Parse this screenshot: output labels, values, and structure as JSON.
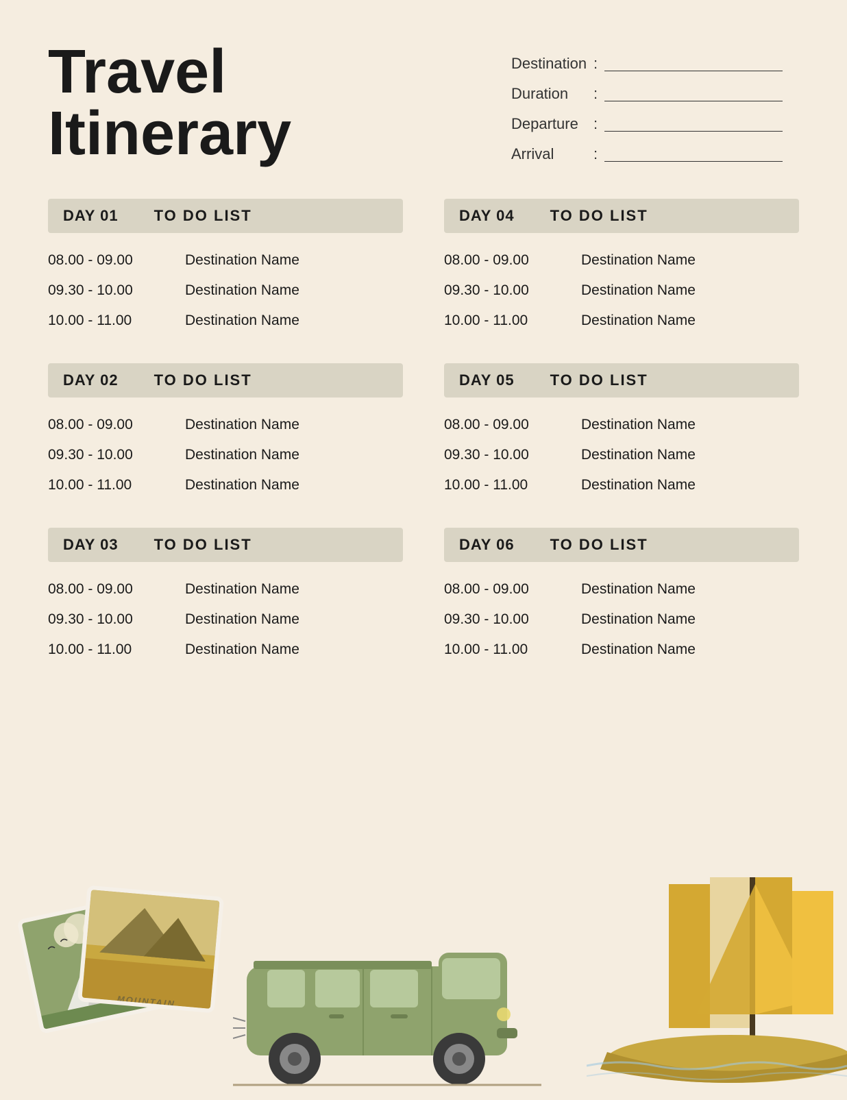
{
  "page": {
    "background_color": "#f5ede0"
  },
  "header": {
    "title_line1": "Travel",
    "title_line2": "Itinerary",
    "info_fields": [
      {
        "label": "Destination",
        "value": ""
      },
      {
        "label": "Duration",
        "value": ""
      },
      {
        "label": "Departure",
        "value": ""
      },
      {
        "label": "Arrival",
        "value": ""
      }
    ]
  },
  "days": [
    {
      "day_label": "DAY 01",
      "todo_label": "TO DO LIST",
      "items": [
        {
          "time": "08.00 - 09.00",
          "name": "Destination Name"
        },
        {
          "time": "09.30 - 10.00",
          "name": "Destination Name"
        },
        {
          "time": "10.00 - 11.00",
          "name": "Destination Name"
        }
      ]
    },
    {
      "day_label": "DAY 04",
      "todo_label": "TO DO LIST",
      "items": [
        {
          "time": "08.00 - 09.00",
          "name": "Destination Name"
        },
        {
          "time": "09.30 - 10.00",
          "name": "Destination Name"
        },
        {
          "time": "10.00 - 11.00",
          "name": "Destination Name"
        }
      ]
    },
    {
      "day_label": "DAY 02",
      "todo_label": "TO DO LIST",
      "items": [
        {
          "time": "08.00 - 09.00",
          "name": "Destination Name"
        },
        {
          "time": "09.30 - 10.00",
          "name": "Destination Name"
        },
        {
          "time": "10.00 - 11.00",
          "name": "Destination Name"
        }
      ]
    },
    {
      "day_label": "DAY 05",
      "todo_label": "TO DO LIST",
      "items": [
        {
          "time": "08.00 - 09.00",
          "name": "Destination Name"
        },
        {
          "time": "09.30 - 10.00",
          "name": "Destination Name"
        },
        {
          "time": "10.00 - 11.00",
          "name": "Destination Name"
        }
      ]
    },
    {
      "day_label": "DAY 03",
      "todo_label": "TO DO LIST",
      "items": [
        {
          "time": "08.00 - 09.00",
          "name": "Destination Name"
        },
        {
          "time": "09.30 - 10.00",
          "name": "Destination Name"
        },
        {
          "time": "10.00 - 11.00",
          "name": "Destination Name"
        }
      ]
    },
    {
      "day_label": "DAY 06",
      "todo_label": "TO DO LIST",
      "items": [
        {
          "time": "08.00 - 09.00",
          "name": "Destination Name"
        },
        {
          "time": "09.30 - 10.00",
          "name": "Destination Name"
        },
        {
          "time": "10.00 - 11.00",
          "name": "Destination Name"
        }
      ]
    }
  ],
  "decorations": {
    "mountain_label": "MOUNTAIN",
    "colors": {
      "card1_bg": "#8fa36d",
      "card2_bg": "#c9b97a",
      "van_body": "#8fa36d",
      "boat_sail1": "#d4a832",
      "boat_sail2": "#f0c040",
      "boat_stripe": "#e8d5a0"
    }
  }
}
